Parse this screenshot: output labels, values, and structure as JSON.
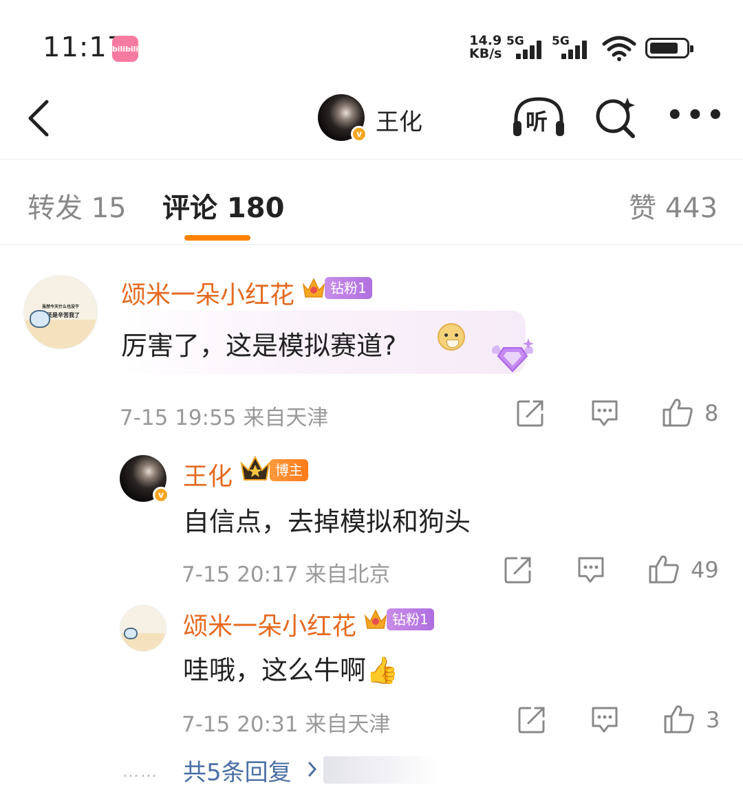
{
  "status_bar": {
    "time": "11:17",
    "app_badge": "bilibili",
    "net_speed_value": "14.9",
    "net_speed_unit": "KB/s",
    "signal1_label": "5G",
    "signal2_label": "5G"
  },
  "header": {
    "name": "王化",
    "listen_label": "听",
    "more_label": "•••"
  },
  "tabs": {
    "repost": "转发 15",
    "comment": "评论 180",
    "like": "赞 443"
  },
  "comments": [
    {
      "username": "颂米一朵小红花",
      "fan_badge": "钻粉1",
      "avatar_text1": "虽然今天什么也没干",
      "avatar_text2": "但还是辛苦我了",
      "text": "厉害了，这是模拟赛道?",
      "time_location": "7-15 19:55  来自天津",
      "likes": "8"
    },
    {
      "username": "王化",
      "fan_badge": "博主",
      "text": "自信点，去掉模拟和狗头",
      "time_location": "7-15 20:17  来自北京",
      "likes": "49"
    },
    {
      "username": "颂米一朵小红花",
      "fan_badge": "钻粉1",
      "text": "哇哦，这么牛啊👍",
      "time_location": "7-15 20:31  来自天津",
      "likes": "3"
    }
  ],
  "more_replies": {
    "dots": "……",
    "label": "共5条回复"
  },
  "colors": {
    "accent_orange": "#ff8200",
    "username_orange": "#e5691f",
    "link_blue": "#4a6fa5",
    "fan_badge_purple": "#b06fe0"
  }
}
